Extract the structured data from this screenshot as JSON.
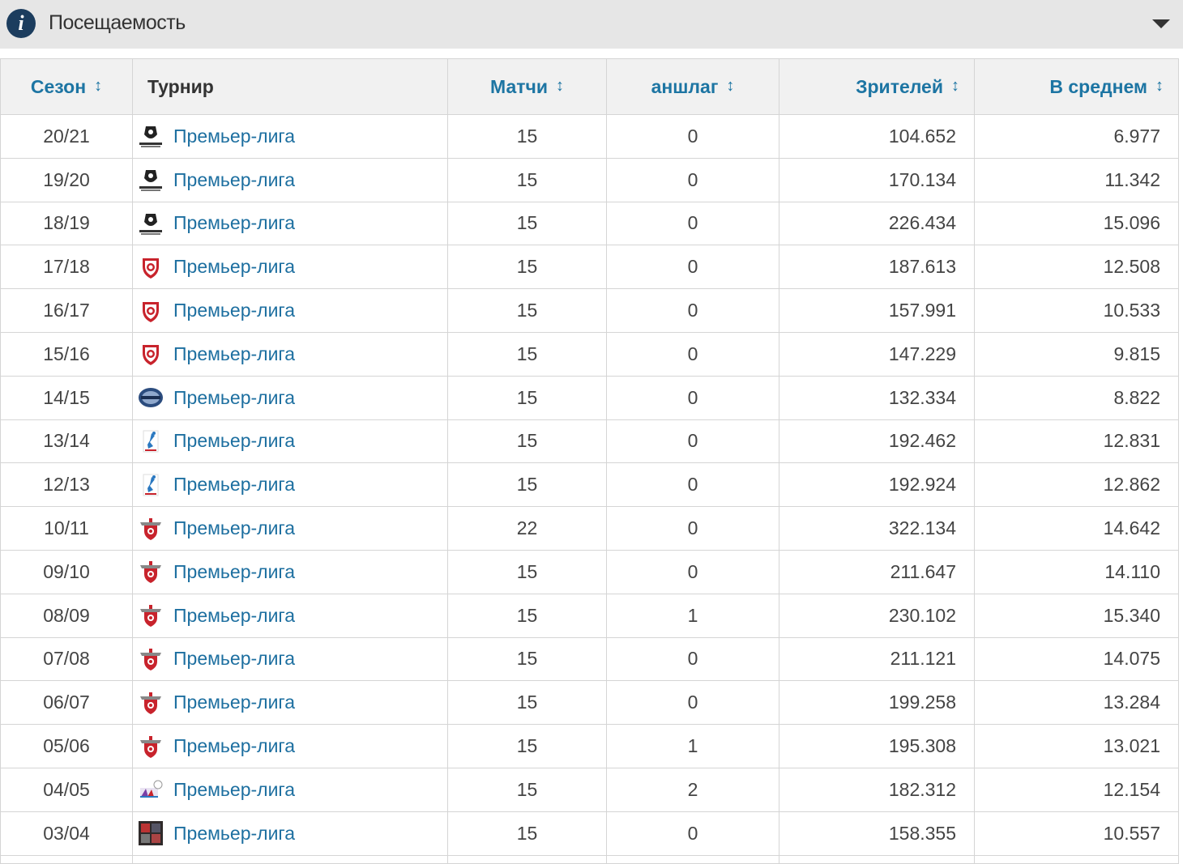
{
  "header": {
    "title": "Посещаемость"
  },
  "table": {
    "columns": [
      {
        "label": "Сезон",
        "sortable": true
      },
      {
        "label": "Турнир",
        "sortable": false
      },
      {
        "label": "Матчи",
        "sortable": true
      },
      {
        "label": "аншлаг",
        "sortable": true
      },
      {
        "label": "Зрителей",
        "sortable": true
      },
      {
        "label": "В среднем",
        "sortable": true
      }
    ],
    "sort_glyph": "↕",
    "rows": [
      {
        "season": "20/21",
        "competition": "Премьер-лига",
        "logo": "league-logo-black-icon",
        "matches": "15",
        "sellouts": "0",
        "spectators": "104.652",
        "average": "6.977"
      },
      {
        "season": "19/20",
        "competition": "Премьер-лига",
        "logo": "league-logo-black-icon",
        "matches": "15",
        "sellouts": "0",
        "spectators": "170.134",
        "average": "11.342"
      },
      {
        "season": "18/19",
        "competition": "Премьер-лига",
        "logo": "league-logo-black-icon",
        "matches": "15",
        "sellouts": "0",
        "spectators": "226.434",
        "average": "15.096"
      },
      {
        "season": "17/18",
        "competition": "Премьер-лига",
        "logo": "league-shield-red-icon",
        "matches": "15",
        "sellouts": "0",
        "spectators": "187.613",
        "average": "12.508"
      },
      {
        "season": "16/17",
        "competition": "Премьер-лига",
        "logo": "league-shield-red-icon",
        "matches": "15",
        "sellouts": "0",
        "spectators": "157.991",
        "average": "10.533"
      },
      {
        "season": "15/16",
        "competition": "Премьер-лига",
        "logo": "league-shield-red-icon",
        "matches": "15",
        "sellouts": "0",
        "spectators": "147.229",
        "average": "9.815"
      },
      {
        "season": "14/15",
        "competition": "Премьер-лига",
        "logo": "league-oval-blue-icon",
        "matches": "15",
        "sellouts": "0",
        "spectators": "132.334",
        "average": "8.822"
      },
      {
        "season": "13/14",
        "competition": "Премьер-лига",
        "logo": "league-player-blue-icon",
        "matches": "15",
        "sellouts": "0",
        "spectators": "192.462",
        "average": "12.831"
      },
      {
        "season": "12/13",
        "competition": "Премьер-лига",
        "logo": "league-player-blue-icon",
        "matches": "15",
        "sellouts": "0",
        "spectators": "192.924",
        "average": "12.862"
      },
      {
        "season": "10/11",
        "competition": "Премьер-лига",
        "logo": "league-crest-red-icon",
        "matches": "22",
        "sellouts": "0",
        "spectators": "322.134",
        "average": "14.642"
      },
      {
        "season": "09/10",
        "competition": "Премьер-лига",
        "logo": "league-crest-red-icon",
        "matches": "15",
        "sellouts": "0",
        "spectators": "211.647",
        "average": "14.110"
      },
      {
        "season": "08/09",
        "competition": "Премьер-лига",
        "logo": "league-crest-red-icon",
        "matches": "15",
        "sellouts": "1",
        "spectators": "230.102",
        "average": "15.340"
      },
      {
        "season": "07/08",
        "competition": "Премьер-лига",
        "logo": "league-crest-red-icon",
        "matches": "15",
        "sellouts": "0",
        "spectators": "211.121",
        "average": "14.075"
      },
      {
        "season": "06/07",
        "competition": "Премьер-лига",
        "logo": "league-crest-red-icon",
        "matches": "15",
        "sellouts": "0",
        "spectators": "199.258",
        "average": "13.284"
      },
      {
        "season": "05/06",
        "competition": "Премьер-лига",
        "logo": "league-crest-red-icon",
        "matches": "15",
        "sellouts": "1",
        "spectators": "195.308",
        "average": "13.021"
      },
      {
        "season": "04/05",
        "competition": "Премьер-лига",
        "logo": "league-colorful-icon",
        "matches": "15",
        "sellouts": "2",
        "spectators": "182.312",
        "average": "12.154"
      },
      {
        "season": "03/04",
        "competition": "Премьер-лига",
        "logo": "league-photo-icon",
        "matches": "15",
        "sellouts": "0",
        "spectators": "158.355",
        "average": "10.557"
      }
    ]
  },
  "colors": {
    "link": "#1d6fa0",
    "header_bg": "#e6e6e6",
    "info_icon": "#1c3d5e"
  }
}
